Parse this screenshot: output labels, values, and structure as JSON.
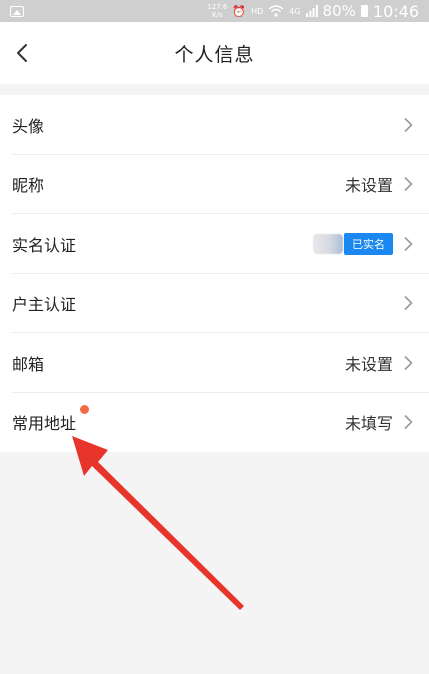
{
  "status_bar": {
    "net_speed_value": "127.6",
    "net_speed_unit": "K/s",
    "hd_label": "HD",
    "signal_label": "4G",
    "battery": "80%",
    "time": "10:46"
  },
  "nav": {
    "title": "个人信息"
  },
  "rows": {
    "avatar": {
      "label": "头像"
    },
    "nickname": {
      "label": "昵称",
      "value": "未设置"
    },
    "real_name": {
      "label": "实名认证",
      "badge": "已实名"
    },
    "householder": {
      "label": "户主认证"
    },
    "email": {
      "label": "邮箱",
      "value": "未设置"
    },
    "address": {
      "label": "常用地址",
      "value": "未填写"
    }
  },
  "colors": {
    "accent_blue": "#1a88f0",
    "red_dot": "#f26b45",
    "annotation_arrow": "#e8352c"
  }
}
